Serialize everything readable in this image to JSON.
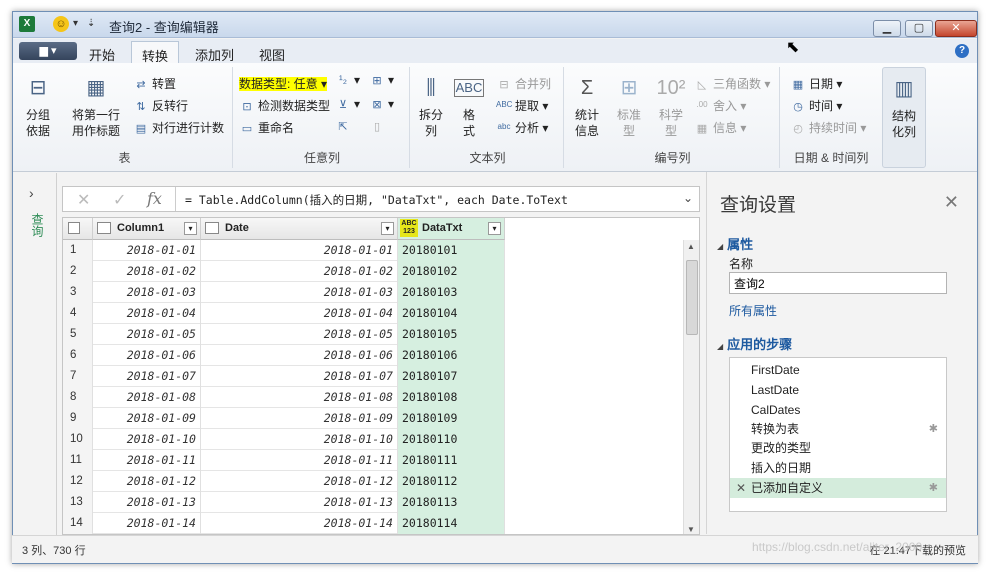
{
  "window": {
    "title": "查询2 - 查询编辑器"
  },
  "tabs": {
    "file": "▆ ▾",
    "items": [
      "开始",
      "转换",
      "添加列",
      "视图"
    ],
    "active": "转换"
  },
  "ribbon": {
    "table_group": {
      "label": "表",
      "group_by": "分组\n依据",
      "first_row": "将第一行\n用作标题",
      "transpose": "转置",
      "reverse": "反转行",
      "count_rows": "对行进行计数"
    },
    "anycol_group": {
      "label": "任意列",
      "data_type": "数据类型: 任意",
      "detect": "检测数据类型",
      "rename": "重命名"
    },
    "text_group": {
      "label": "文本列",
      "split": "拆分\n列",
      "format": "格\n式",
      "merge": "合并列",
      "extract": "提取",
      "parse": "分析"
    },
    "number_group": {
      "label": "编号列",
      "stats": "统计\n信息",
      "standard": "标准\n型",
      "scientific": "科学\n型",
      "trig": "三角函数",
      "round": "舍入",
      "info": "信息"
    },
    "datetime_group": {
      "label": "日期 & 时间列",
      "date": "日期",
      "time": "时间",
      "duration": "持续时间",
      "structured": "结构\n化列"
    }
  },
  "formula_bar": {
    "text": "= Table.AddColumn(插入的日期, \"DataTxt\", each Date.ToText"
  },
  "left_panel": {
    "label": "查询"
  },
  "table": {
    "columns": [
      "Column1",
      "Date",
      "DataTxt"
    ],
    "type_badge": "ABC\n123",
    "rows": [
      [
        "1",
        "2018-01-01",
        "2018-01-01",
        "20180101"
      ],
      [
        "2",
        "2018-01-02",
        "2018-01-02",
        "20180102"
      ],
      [
        "3",
        "2018-01-03",
        "2018-01-03",
        "20180103"
      ],
      [
        "4",
        "2018-01-04",
        "2018-01-04",
        "20180104"
      ],
      [
        "5",
        "2018-01-05",
        "2018-01-05",
        "20180105"
      ],
      [
        "6",
        "2018-01-06",
        "2018-01-06",
        "20180106"
      ],
      [
        "7",
        "2018-01-07",
        "2018-01-07",
        "20180107"
      ],
      [
        "8",
        "2018-01-08",
        "2018-01-08",
        "20180108"
      ],
      [
        "9",
        "2018-01-09",
        "2018-01-09",
        "20180109"
      ],
      [
        "10",
        "2018-01-10",
        "2018-01-10",
        "20180110"
      ],
      [
        "11",
        "2018-01-11",
        "2018-01-11",
        "20180111"
      ],
      [
        "12",
        "2018-01-12",
        "2018-01-12",
        "20180112"
      ],
      [
        "13",
        "2018-01-13",
        "2018-01-13",
        "20180113"
      ],
      [
        "14",
        "2018-01-14",
        "2018-01-14",
        "20180114"
      ]
    ]
  },
  "query_settings": {
    "title": "查询设置",
    "properties_label": "属性",
    "name_label": "名称",
    "name_value": "查询2",
    "all_properties": "所有属性",
    "steps_label": "应用的步骤",
    "steps": [
      "FirstDate",
      "LastDate",
      "CalDates",
      "转换为表",
      "更改的类型",
      "插入的日期",
      "已添加自定义"
    ]
  },
  "status": {
    "left": "3 列、730 行",
    "right": "在 21:47下载的预览"
  },
  "watermark": "https://blog.csdn.net/aliter_2000",
  "colors": {
    "highlight": "#ffff00",
    "selected_col": "#d6efe0",
    "link": "#1e5aa0",
    "query_label": "#2f8d57"
  }
}
